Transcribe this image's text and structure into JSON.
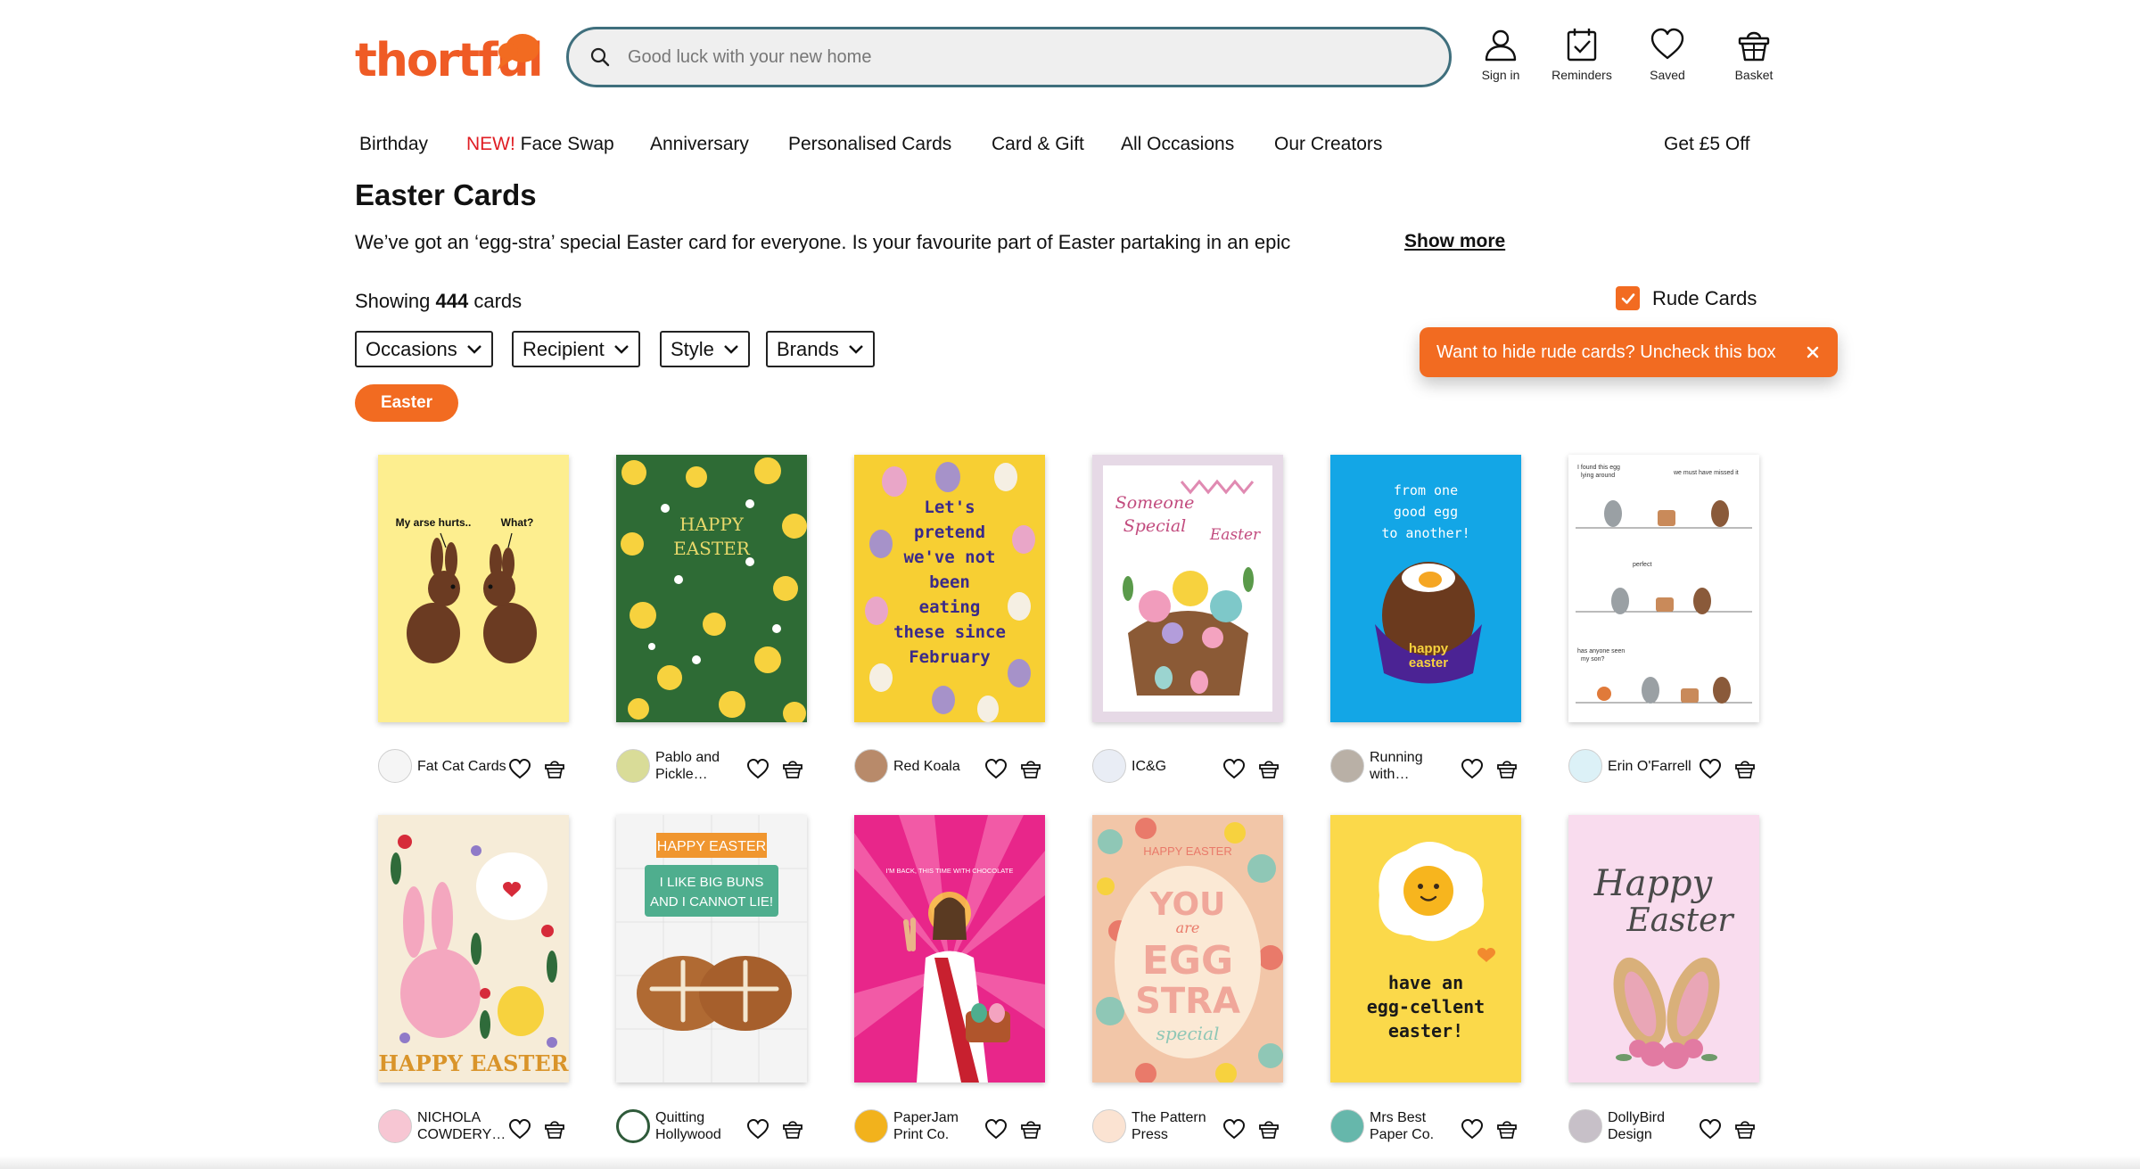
{
  "header": {
    "logo_text": "thortful",
    "search_placeholder": "Good luck with your new home",
    "actions": [
      {
        "label": "Sign in",
        "icon": "user-icon"
      },
      {
        "label": "Reminders",
        "icon": "calendar-check-icon"
      },
      {
        "label": "Saved",
        "icon": "heart-icon"
      },
      {
        "label": "Basket",
        "icon": "basket-icon"
      }
    ]
  },
  "nav": {
    "items": [
      "Birthday",
      "Face Swap",
      "Anniversary",
      "Personalised Cards",
      "Card & Gift",
      "All Occasions",
      "Our Creators"
    ],
    "new_badge": "NEW!",
    "promo": "Get £5 Off"
  },
  "page": {
    "title": "Easter Cards",
    "description": "We’ve got an ‘egg-stra’ special Easter card for everyone. Is your favourite part of Easter partaking in an epic",
    "show_more": "Show more",
    "showing_prefix": "Showing",
    "count": "444",
    "showing_suffix": "cards"
  },
  "filters": [
    "Occasions",
    "Recipient",
    "Style",
    "Brands"
  ],
  "active_chip": "Easter",
  "rude_toggle": {
    "label": "Rude Cards",
    "checked": true
  },
  "tooltip": {
    "text": "Want to hide rude cards? Uncheck this box",
    "close": "×"
  },
  "colors": {
    "brand": "#f26b21",
    "search_border": "#3f6f7d",
    "new_badge": "#e01e24"
  },
  "cards": [
    {
      "creator": "Fat Cat Cards",
      "text": [
        "My arse hurts..",
        "What?"
      ],
      "theme": "chocolate-bunnies"
    },
    {
      "creator": "Pablo and Pickle…",
      "text": [
        "HAPPY",
        "EASTER"
      ],
      "theme": "daffodils"
    },
    {
      "creator": "Red Koala",
      "text": [
        "Let's",
        "pretend",
        "we've not",
        "been",
        "eating",
        "these since",
        "February"
      ],
      "theme": "mini-eggs"
    },
    {
      "creator": "IC&G",
      "text": [
        "Someone",
        "Special",
        "Easter"
      ],
      "theme": "floral-basket"
    },
    {
      "creator": "Running with…",
      "text": [
        "from one",
        "good egg",
        "to another!",
        "happy",
        "easter"
      ],
      "theme": "creme-egg"
    },
    {
      "creator": "Erin O'Farrell",
      "text": [
        "I found this egg",
        "lying around",
        "we must have missed it",
        "perfect",
        "has anyone seen",
        "my son?"
      ],
      "theme": "rabbit-comic"
    },
    {
      "creator": "NICHOLA COWDERY…",
      "text": [
        "HAPPY EASTER"
      ],
      "theme": "folk-bunny"
    },
    {
      "creator": "Quitting Hollywood",
      "text": [
        "HAPPY EASTER",
        "I LIKE BIG BUNS",
        "AND I CANNOT LIE!"
      ],
      "theme": "hot-cross-buns"
    },
    {
      "creator": "PaperJam Print Co.",
      "text": [
        "I'M BACK, THIS TIME WITH CHOCOLATE"
      ],
      "theme": "jesus"
    },
    {
      "creator": "The Pattern Press",
      "text": [
        "HAPPY EASTER",
        "YOU",
        "are",
        "EGG",
        "STRA",
        "special"
      ],
      "theme": "pattern-egg"
    },
    {
      "creator": "Mrs Best Paper Co.",
      "text": [
        "have an",
        "egg-cellent",
        "easter!"
      ],
      "theme": "fried-egg"
    },
    {
      "creator": "DollyBird Design",
      "text": [
        "Happy",
        "Easter"
      ],
      "theme": "bunny-ears"
    }
  ]
}
